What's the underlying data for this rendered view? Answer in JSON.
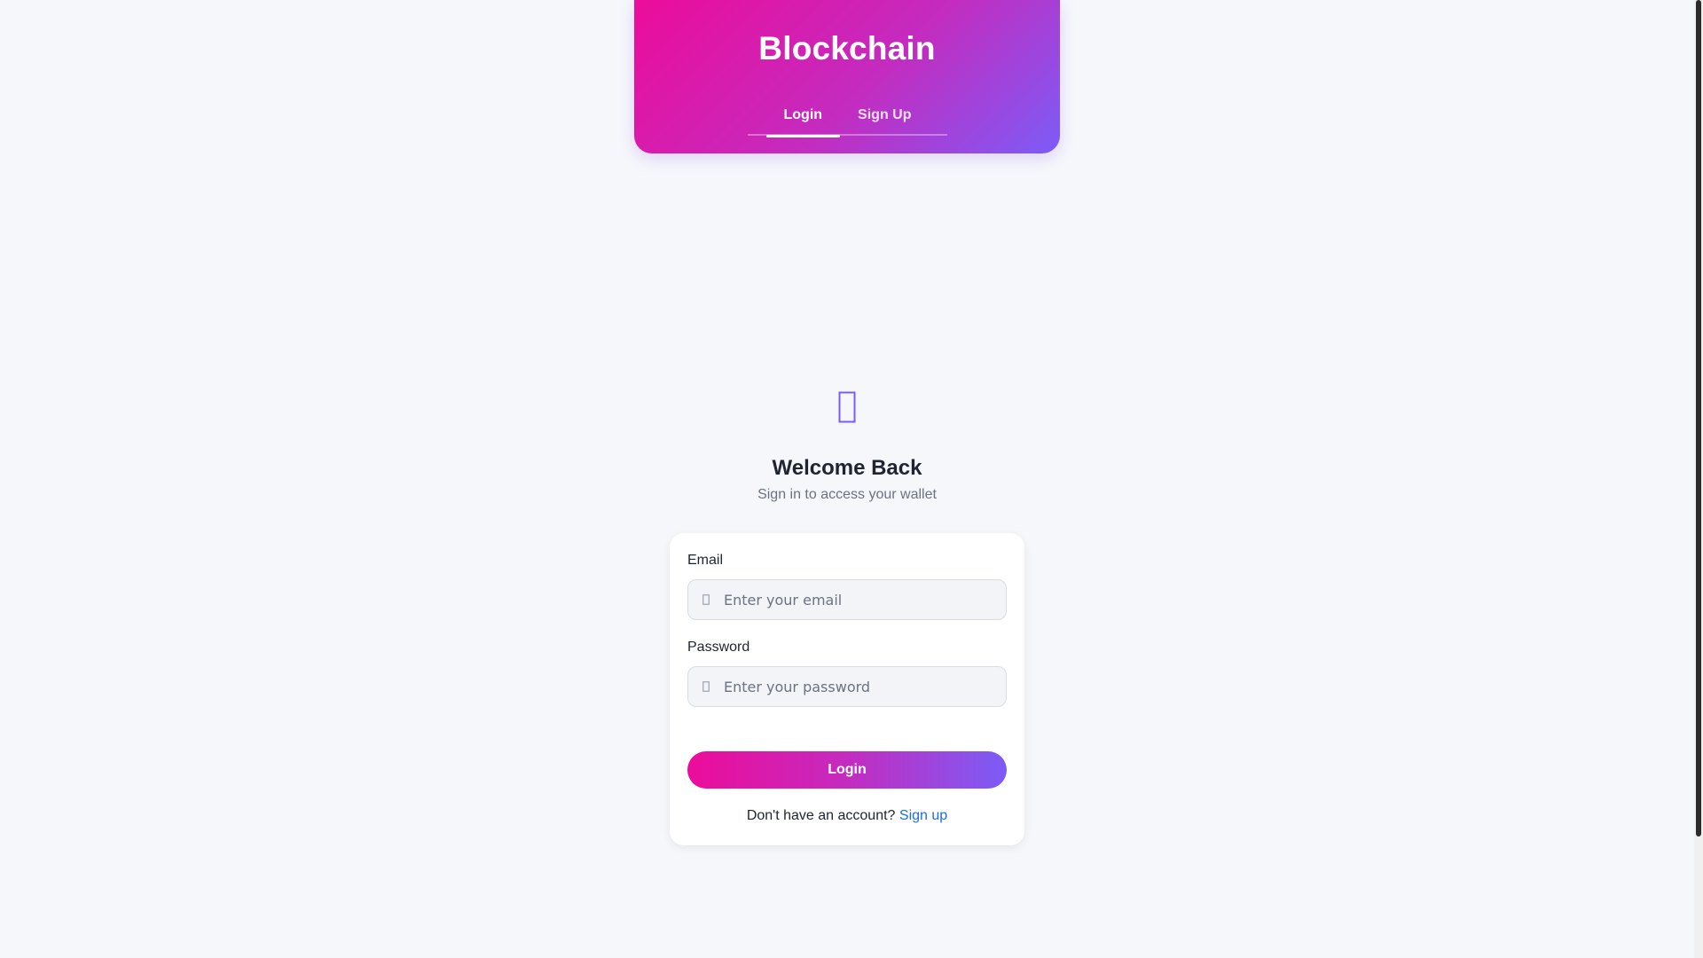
{
  "header": {
    "brand": "Blockchain",
    "tabs": [
      {
        "label": "Login",
        "active": true
      },
      {
        "label": "Sign Up",
        "active": false
      }
    ]
  },
  "hero": {
    "icon": "wallet-icon",
    "title": "Welcome Back",
    "subtitle": "Sign in to access your wallet"
  },
  "form": {
    "email_label": "Email",
    "email_placeholder": "Enter your email",
    "email_value": "",
    "password_label": "Password",
    "password_placeholder": "Enter your password",
    "password_value": "",
    "submit_label": "Login",
    "signup_prompt": "Don't have an account?",
    "signup_link": "Sign up"
  },
  "colors": {
    "gradient_start": "#ec0c9a",
    "gradient_end": "#7c5cf7",
    "accent_icon": "#7c5cf7",
    "link": "#1a6fe0",
    "background": "#f6f7fb"
  }
}
